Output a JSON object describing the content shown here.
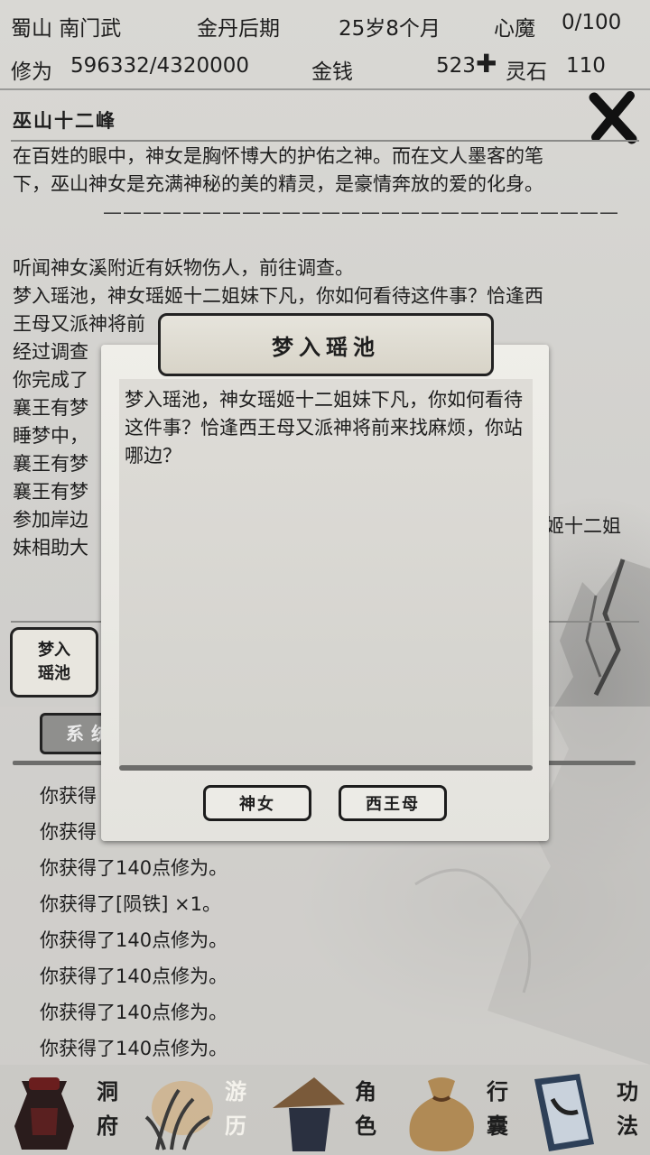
{
  "status": {
    "location": "蜀山 南门武",
    "realm": "金丹后期",
    "age": "25岁8个月",
    "heart_demon_label": "心魔",
    "heart_demon_value": "0/100",
    "cultivation_label": "修为",
    "cultivation_value": "596332/4320000",
    "money_label": "金钱",
    "money_value": "523",
    "spirit_stone_label": "灵石",
    "spirit_stone_value": "110"
  },
  "detail": {
    "title": "巫山十二峰",
    "lines": [
      "在百姓的眼中，神女是胸怀博大的护佑之神。而在文人墨客的笔",
      "下，巫山神女是充满神秘的美的精灵，是豪情奔放的爱的化身。",
      "——————————————————————————",
      "",
      "听闻神女溪附近有妖物伤人，前往调查。",
      "梦入瑶池，神女瑶姬十二姐妹下凡，你如何看待这件事？恰逢西",
      "王母又派神将前",
      "经过调查",
      "你完成了",
      "襄王有梦",
      "睡梦中，",
      "襄王有梦",
      "襄王有梦",
      "参加岸边",
      "妹相助大"
    ],
    "line_tail_1": "姬十二姐"
  },
  "event_button": {
    "label_1": "梦入",
    "label_2": "瑶池"
  },
  "log": {
    "tab_label": "系统",
    "items": [
      "你获得",
      "你获得",
      "你获得了140点修为。",
      "你获得了[陨铁] ×1。",
      "你获得了140点修为。",
      "你获得了140点修为。",
      "你获得了140点修为。",
      "你获得了140点修为。"
    ]
  },
  "modal": {
    "title": "梦入瑶池",
    "text": "梦入瑶池，神女瑶姬十二姐妹下凡，你如何看待这件事？恰逢西王母又派神将前来找麻烦，你站哪边？",
    "choice_1": "神女",
    "choice_2": "西王母"
  },
  "nav": {
    "items": [
      {
        "label_1": "洞",
        "label_2": "府"
      },
      {
        "label_1": "游",
        "label_2": "历"
      },
      {
        "label_1": "角",
        "label_2": "色"
      },
      {
        "label_1": "行",
        "label_2": "囊"
      },
      {
        "label_1": "功",
        "label_2": "法"
      }
    ]
  }
}
